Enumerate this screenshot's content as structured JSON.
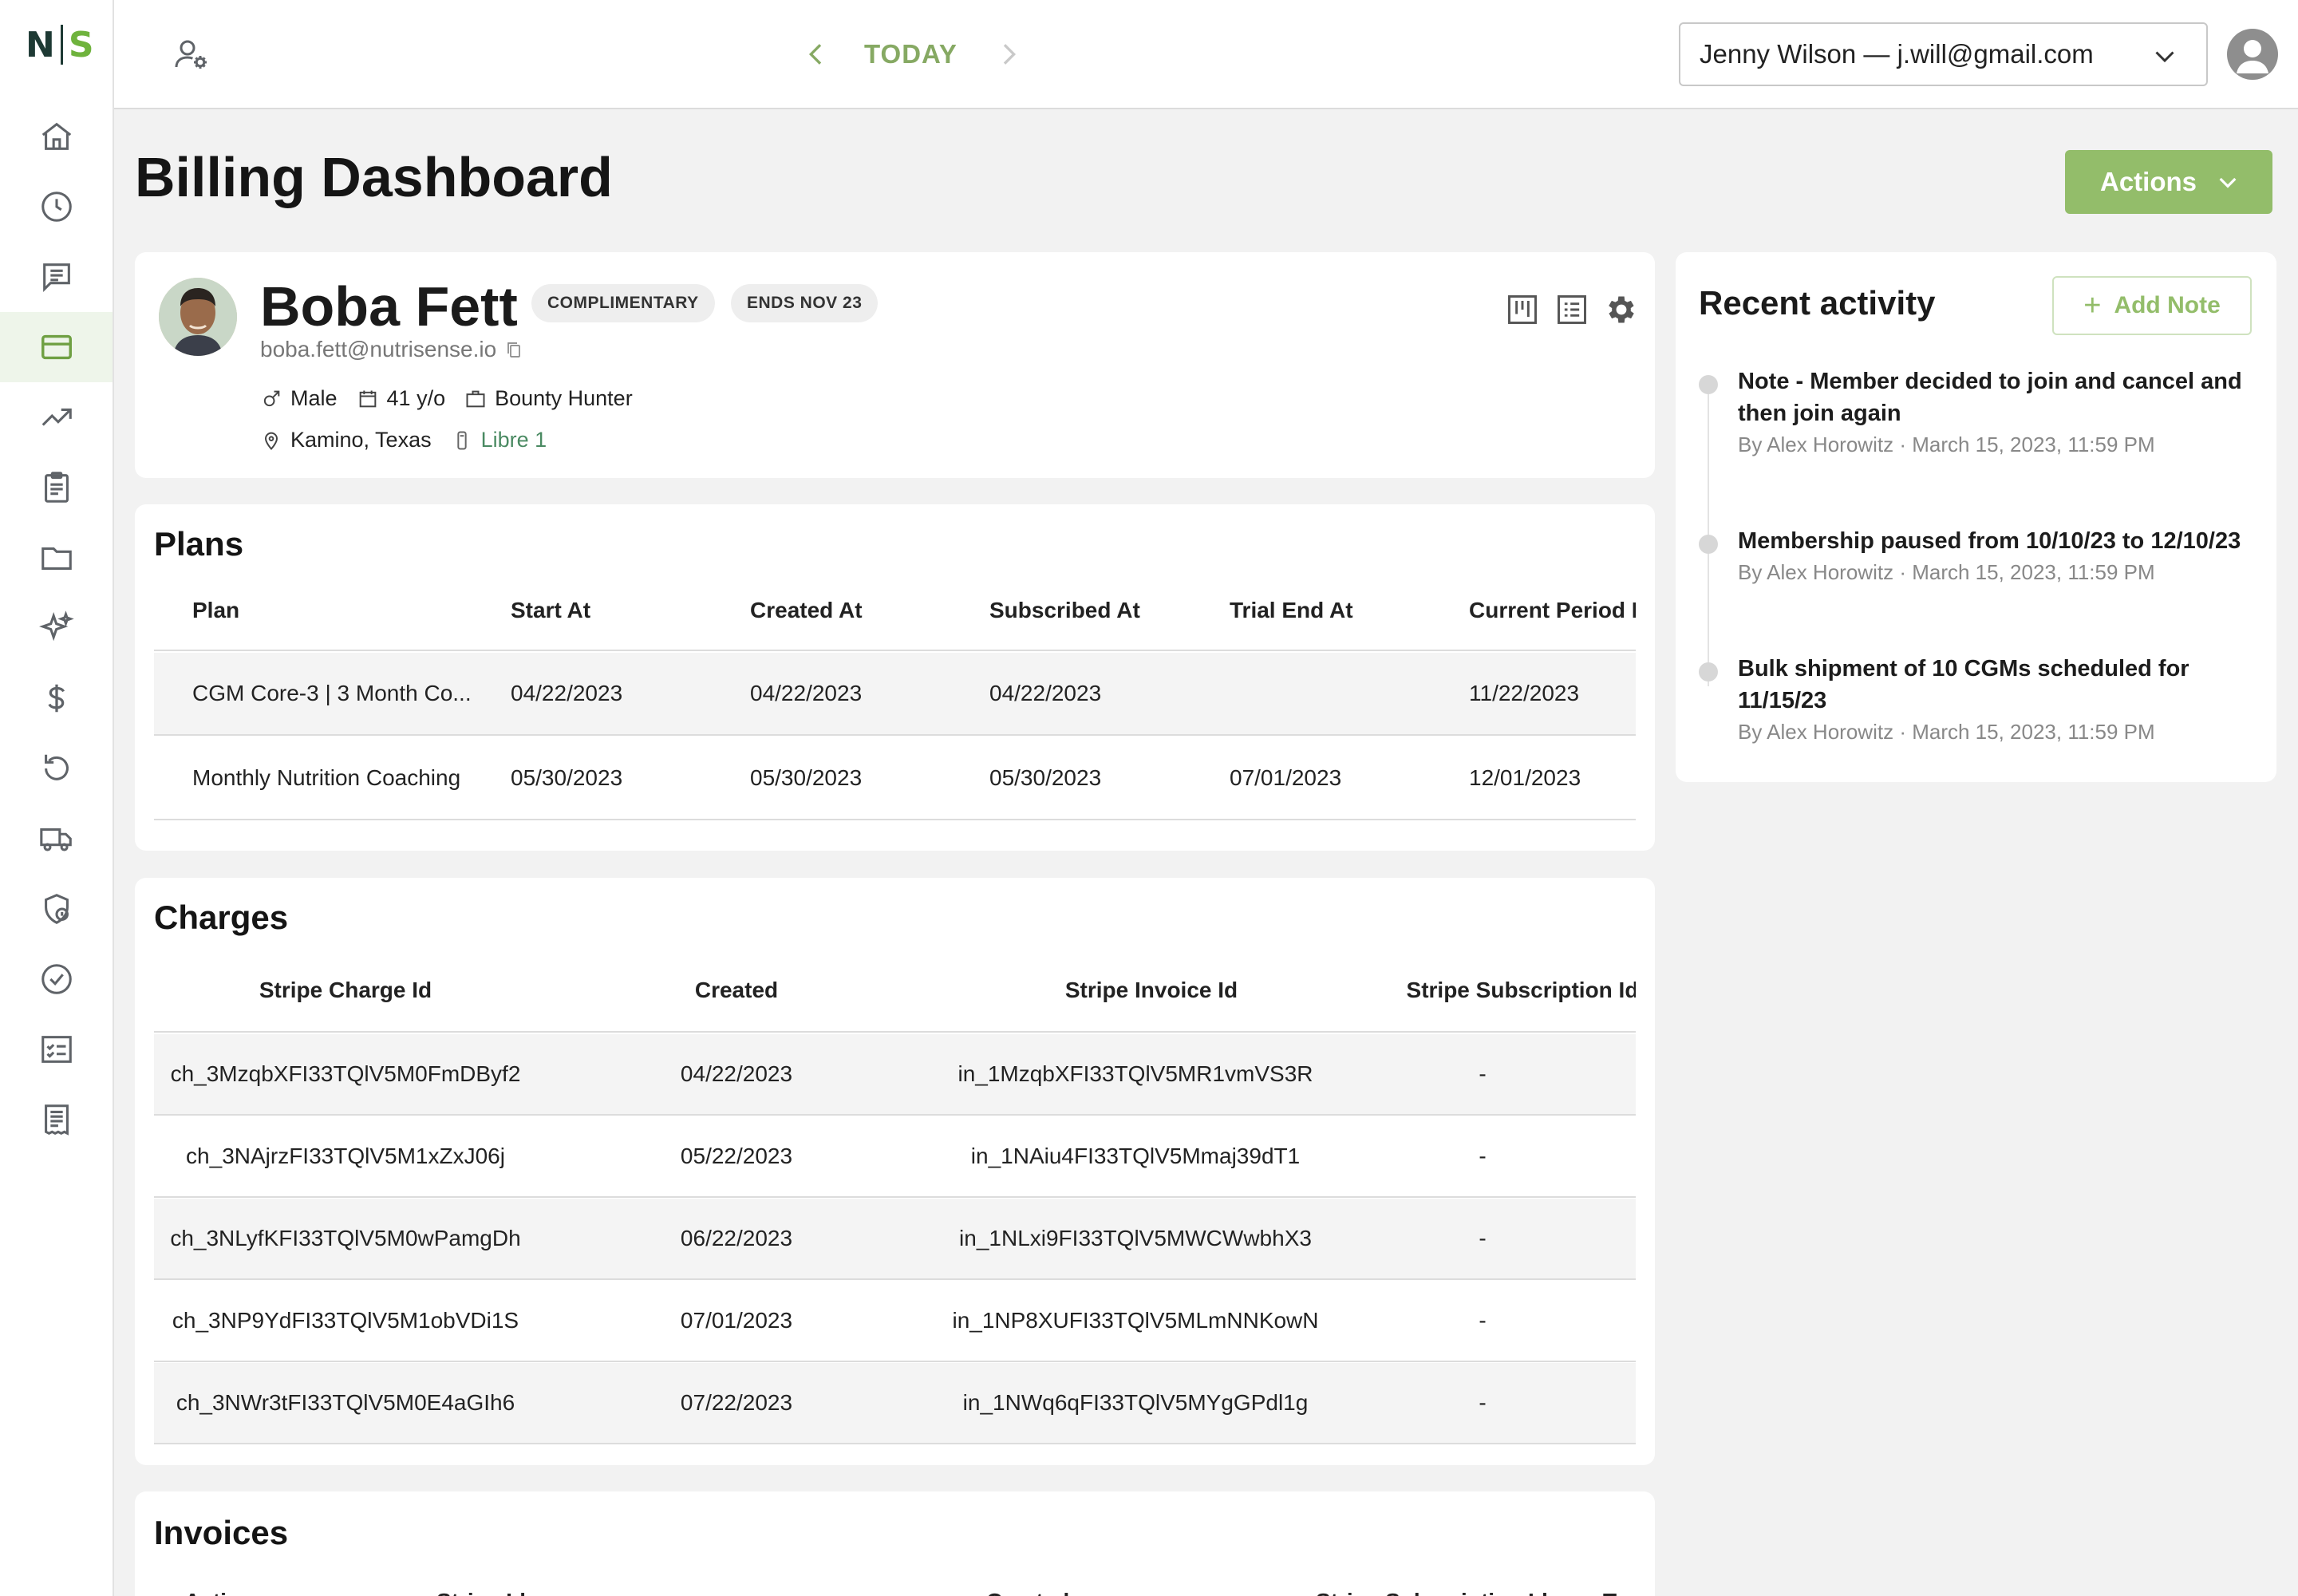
{
  "brand": {
    "logo_left": "N",
    "logo_right": "S",
    "accent": "#93bd6a",
    "dark": "#1e3a34"
  },
  "topbar": {
    "today_label": "TODAY",
    "user_select_value": "Jenny Wilson — j.will@gmail.com"
  },
  "sidebar": {
    "items": [
      {
        "icon": "home-icon"
      },
      {
        "icon": "clock-icon"
      },
      {
        "icon": "chat-icon"
      },
      {
        "icon": "credit-card-icon",
        "active": true
      },
      {
        "icon": "trending-up-icon"
      },
      {
        "icon": "clipboard-icon"
      },
      {
        "icon": "folder-icon"
      },
      {
        "icon": "sparkles-icon"
      },
      {
        "icon": "dollar-icon"
      },
      {
        "icon": "refresh-icon"
      },
      {
        "icon": "truck-icon"
      },
      {
        "icon": "shield-user-icon"
      },
      {
        "icon": "check-circle-icon"
      },
      {
        "icon": "checklist-icon"
      },
      {
        "icon": "receipt-icon"
      }
    ]
  },
  "header": {
    "title": "Billing Dashboard",
    "actions_label": "Actions"
  },
  "member": {
    "name": "Boba Fett",
    "badges": [
      "COMPLIMENTARY",
      "ENDS NOV 23"
    ],
    "email": "boba.fett@nutrisense.io",
    "sex": "Male",
    "age": "41 y/o",
    "occupation": "Bounty Hunter",
    "location": "Kamino, Texas",
    "device": "Libre 1"
  },
  "plans": {
    "title": "Plans",
    "columns": [
      "Plan",
      "Start At",
      "Created At",
      "Subscribed At",
      "Trial End At",
      "Current Period E"
    ],
    "rows": [
      [
        "CGM Core-3 | 3 Month Co...",
        "04/22/2023",
        "04/22/2023",
        "04/22/2023",
        "",
        "11/22/2023"
      ],
      [
        "Monthly Nutrition Coaching",
        "05/30/2023",
        "05/30/2023",
        "05/30/2023",
        "07/01/2023",
        "12/01/2023"
      ]
    ]
  },
  "charges": {
    "title": "Charges",
    "columns": [
      "Stripe Charge Id",
      "Created",
      "Stripe Invoice Id",
      "Stripe Subscription Id"
    ],
    "rows": [
      [
        "ch_3MzqbXFI33TQlV5M0FmDByf2",
        "04/22/2023",
        "in_1MzqbXFI33TQlV5MR1vmVS3R",
        "-"
      ],
      [
        "ch_3NAjrzFI33TQlV5M1xZxJ06j",
        "05/22/2023",
        "in_1NAiu4FI33TQlV5Mmaj39dT1",
        "-"
      ],
      [
        "ch_3NLyfKFI33TQlV5M0wPamgDh",
        "06/22/2023",
        "in_1NLxi9FI33TQlV5MWCWwbhX3",
        "-"
      ],
      [
        "ch_3NP9YdFI33TQlV5M1obVDi1S",
        "07/01/2023",
        "in_1NP8XUFI33TQlV5MLmNNKowN",
        "-"
      ],
      [
        "ch_3NWr3tFI33TQlV5M0E4aGIh6",
        "07/22/2023",
        "in_1NWq6qFI33TQlV5MYgGPdl1g",
        "-"
      ]
    ]
  },
  "invoices": {
    "title": "Invoices",
    "columns": [
      "Actions",
      "Stripe Id",
      "Created",
      "Stripe Subscription Id",
      "T"
    ]
  },
  "activity": {
    "title": "Recent activity",
    "add_note_label": "Add Note",
    "items": [
      {
        "text": "Note - Member decided to join and cancel and then join again",
        "author": "By Alex Horowitz",
        "date": "March 15, 2023, 11:59 PM"
      },
      {
        "text": "Membership paused from 10/10/23 to 12/10/23",
        "author": "By Alex Horowitz",
        "date": "March 15, 2023, 11:59 PM"
      },
      {
        "text": "Bulk shipment of 10 CGMs scheduled for 11/15/23",
        "author": "By Alex Horowitz",
        "date": "March 15, 2023, 11:59 PM"
      }
    ]
  }
}
